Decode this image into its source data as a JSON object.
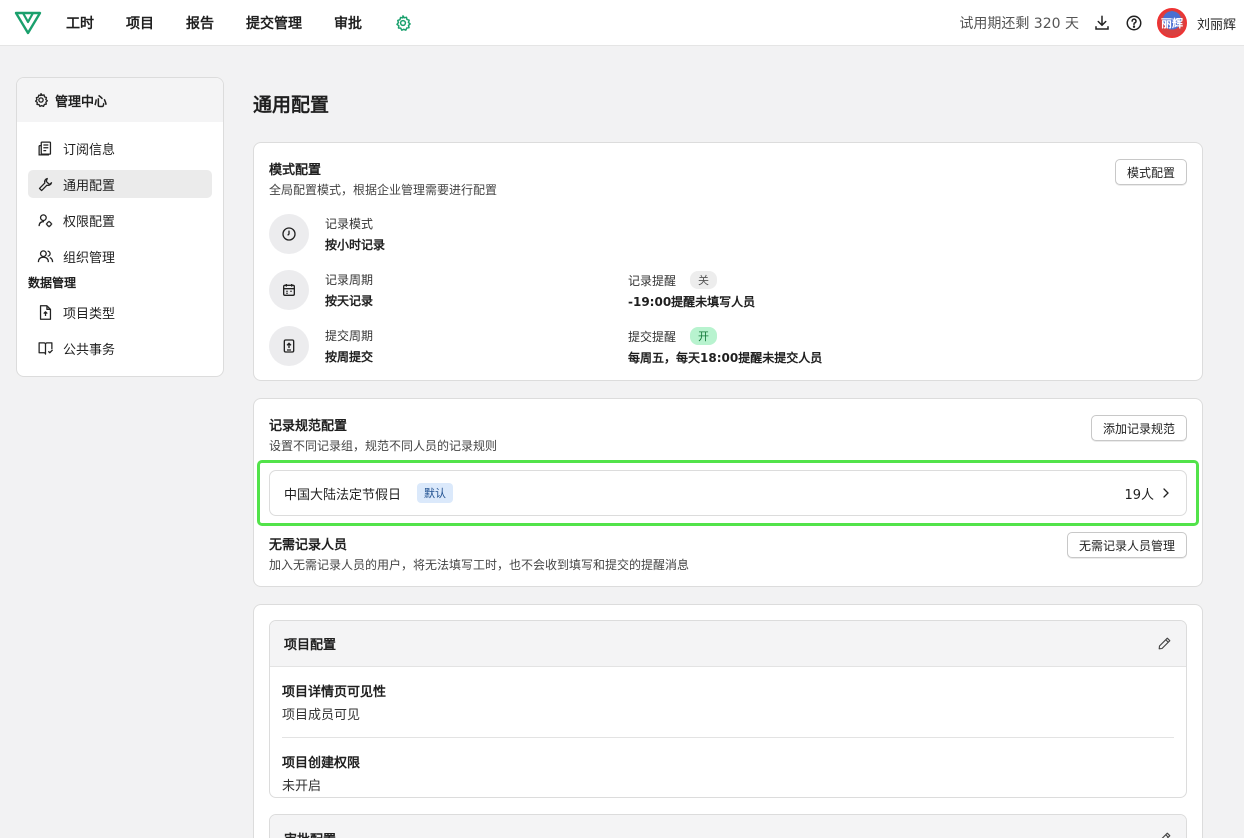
{
  "nav": {
    "items": [
      "工时",
      "项目",
      "报告",
      "提交管理",
      "审批"
    ],
    "settings_icon": "gear-icon",
    "accent": "#1aa06d"
  },
  "topright": {
    "trial": "试用期还剩 320 天",
    "avatar_text": "丽辉",
    "username": "刘丽辉"
  },
  "sidebar": {
    "header": "管理中心",
    "items": [
      {
        "label": "订阅信息",
        "icon": "receipt-icon"
      },
      {
        "label": "通用配置",
        "icon": "wrench-icon",
        "active": true
      },
      {
        "label": "权限配置",
        "icon": "user-gear-icon"
      },
      {
        "label": "组织管理",
        "icon": "users-icon"
      }
    ],
    "section": "数据管理",
    "data_items": [
      {
        "label": "项目类型",
        "icon": "file-icon"
      },
      {
        "label": "公共事务",
        "icon": "book-icon"
      }
    ]
  },
  "main": {
    "title": "通用配置",
    "mode_card": {
      "title": "模式配置",
      "desc": "全局配置模式，根据企业管理需要进行配置",
      "button": "模式配置",
      "record_mode_label": "记录模式",
      "record_mode_value": "按小时记录",
      "record_period_label": "记录周期",
      "record_period_value": "按天记录",
      "record_reminder_label": "记录提醒",
      "record_reminder_status": "关",
      "record_reminder_value": "-19:00提醒未填写人员",
      "submit_period_label": "提交周期",
      "submit_period_value": "按周提交",
      "submit_reminder_label": "提交提醒",
      "submit_reminder_status": "开",
      "submit_reminder_value": "每周五，每天18:00提醒未提交人员"
    },
    "rule_card": {
      "title": "记录规范配置",
      "desc": "设置不同记录组，规范不同人员的记录规则",
      "button": "添加记录规范",
      "rule_name": "中国大陆法定节假日",
      "rule_badge": "默认",
      "rule_count": "19人",
      "exempt_title": "无需记录人员",
      "exempt_desc": "加入无需记录人员的用户，将无法填写工时，也不会收到填写和提交的提醒消息",
      "exempt_button": "无需记录人员管理"
    },
    "project_card": {
      "title": "项目配置",
      "detail_title": "项目详情页可见性",
      "detail_value": "项目成员可见",
      "create_title": "项目创建权限",
      "create_value": "未开启"
    },
    "approval_card": {
      "title": "审批配置"
    }
  }
}
